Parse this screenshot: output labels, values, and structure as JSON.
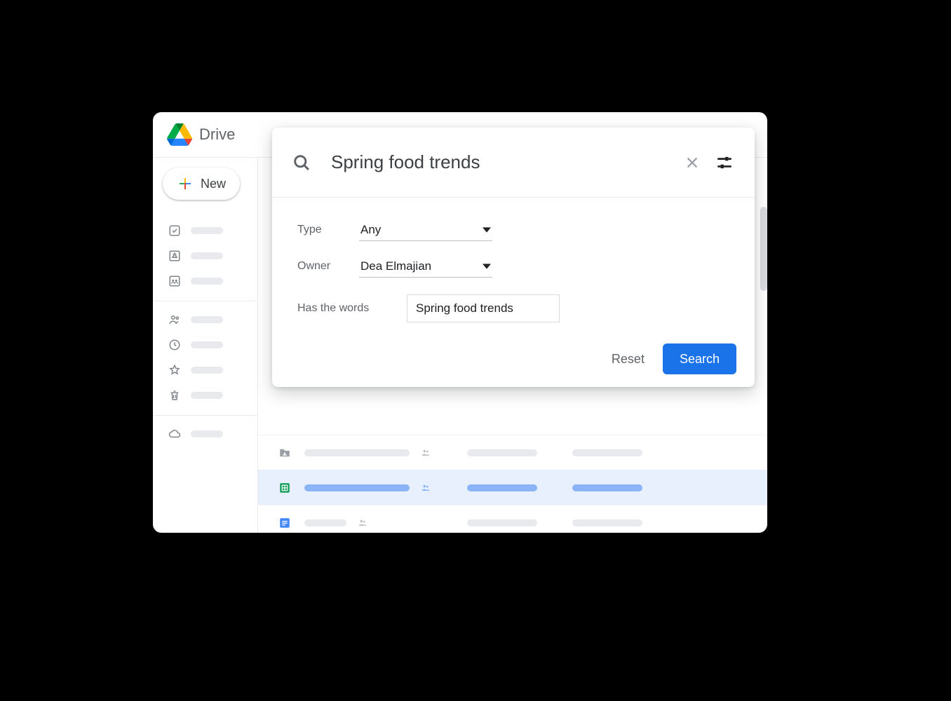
{
  "header": {
    "app_name": "Drive"
  },
  "sidebar": {
    "new_label": "New"
  },
  "search": {
    "query": "Spring food trends",
    "filters": {
      "type_label": "Type",
      "type_value": "Any",
      "owner_label": "Owner",
      "owner_value": "Dea Elmajian",
      "words_label": "Has the words",
      "words_value": "Spring food trends"
    },
    "reset_label": "Reset",
    "search_label": "Search"
  }
}
